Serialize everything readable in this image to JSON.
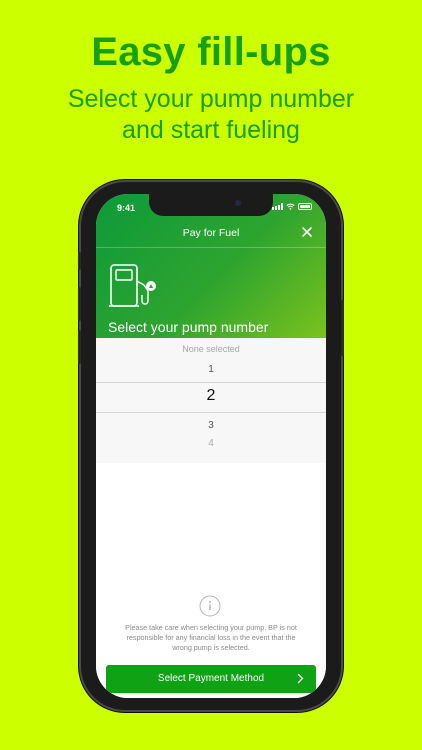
{
  "marketing": {
    "headline": "Easy fill-ups",
    "subline_1": "Select your pump number",
    "subline_2": "and start fueling"
  },
  "status_bar": {
    "time": "9:41"
  },
  "nav": {
    "title": "Pay for Fuel",
    "close_icon": "close-icon"
  },
  "header": {
    "pump_icon": "fuel-pump-icon",
    "title": "Select your pump number"
  },
  "picker": {
    "placeholder": "None selected",
    "options": [
      "1",
      "2",
      "3",
      "4"
    ],
    "selected": "2"
  },
  "info": {
    "icon": "info-icon",
    "disclaimer": "Please take care when selecting your pump. BP is not responsible for any financial loss in the event that the wrong pump is selected."
  },
  "cta": {
    "label": "Select Payment Method",
    "icon": "chevron-right-icon"
  },
  "colors": {
    "background": "#ccff00",
    "marketing_text": "#16a016",
    "header_gradient_start": "#0d9a3a",
    "header_gradient_end": "#7bc21d",
    "button": "#0ea214"
  }
}
